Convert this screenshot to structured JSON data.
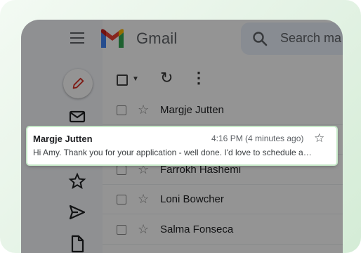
{
  "app": {
    "brand": "Gmail"
  },
  "search": {
    "placeholder": "Search ma"
  },
  "toolbar": {
    "refresh_icon": "refresh-icon",
    "more_icon": "more-vert-icon"
  },
  "nav": {
    "icons": [
      "pencil-icon",
      "mail-icon",
      "star-icon",
      "send-icon",
      "file-icon"
    ]
  },
  "emails": [
    {
      "sender": "Margje Jutten"
    },
    {
      "sender": "Farrokh Hashemi"
    },
    {
      "sender": "Loni Bowcher"
    },
    {
      "sender": "Salma Fonseca"
    }
  ],
  "notification": {
    "sender": "Margje Jutten",
    "time": "4:16 PM (4 minutes ago)",
    "snippet": "Hi Amy. Thank you for your application - well done. I'd love to schedule a…"
  },
  "colors": {
    "gmail_red": "#ea4335",
    "gmail_blue": "#4285f4",
    "gmail_green": "#34a853",
    "gmail_yellow": "#fbbc04",
    "frame_green": "#d4ecd6",
    "overlay": "rgba(0,0,0,0.42)"
  }
}
